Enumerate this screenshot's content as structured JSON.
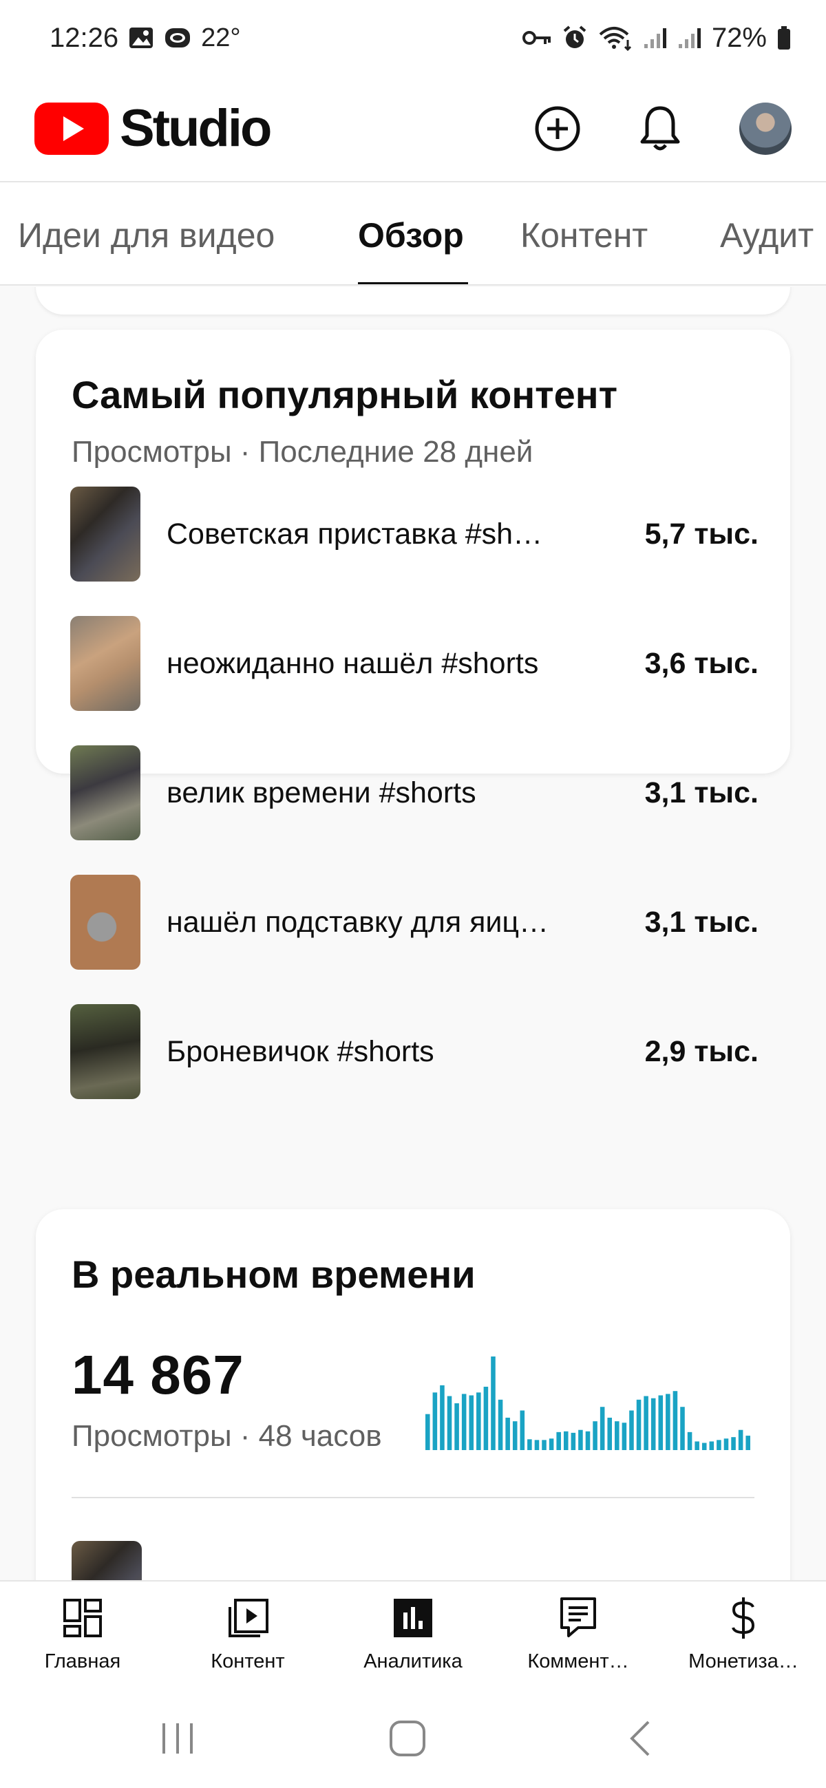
{
  "status_bar": {
    "time": "12:26",
    "temperature": "22°",
    "battery": "72%",
    "icons": [
      "image-icon",
      "outlook-icon",
      "key-icon",
      "alarm-icon",
      "wifi-icon",
      "signal-icon",
      "signal-icon",
      "battery-icon"
    ]
  },
  "header": {
    "app_name": "Studio",
    "brand_color": "#ff0000",
    "icons": [
      "create-icon",
      "notifications-icon",
      "avatar"
    ]
  },
  "tabs": [
    {
      "label": "Идеи для видео",
      "active": false
    },
    {
      "label": "Обзор",
      "active": true
    },
    {
      "label": "Контент",
      "active": false
    },
    {
      "label": "Аудит",
      "active": false
    }
  ],
  "top_content": {
    "title": "Самый популярный контент",
    "subtitle": "Просмотры · Последние 28 дней",
    "items": [
      {
        "title": "Советская приставка #sh…",
        "views": "5,7 тыс."
      },
      {
        "title": "неожиданно нашёл #shorts",
        "views": "3,6 тыс."
      },
      {
        "title": "велик времени #shorts",
        "views": "3,1 тыс."
      },
      {
        "title": "нашёл подставку для яиц…",
        "views": "3,1 тыс."
      },
      {
        "title": "Броневичок #shorts",
        "views": "2,9 тыс."
      }
    ]
  },
  "realtime": {
    "title": "В реальном времени",
    "views_count": "14 867",
    "subtitle": "Просмотры · 48 часов",
    "bar_color": "#1aa3c4",
    "hourly_bars": [
      50,
      80,
      90,
      75,
      65,
      78,
      76,
      80,
      88,
      130,
      70,
      45,
      40,
      55,
      15,
      14,
      14,
      16,
      25,
      26,
      24,
      28,
      26,
      40,
      60,
      45,
      40,
      38,
      55,
      70,
      75,
      72,
      76,
      78,
      82,
      60,
      25,
      12,
      10,
      12,
      14,
      16,
      18,
      28,
      20
    ]
  },
  "bottom_nav": [
    {
      "label": "Главная",
      "icon": "dashboard-icon",
      "active": false
    },
    {
      "label": "Контент",
      "icon": "content-icon",
      "active": false
    },
    {
      "label": "Аналитика",
      "icon": "analytics-icon",
      "active": true
    },
    {
      "label": "Коммент…",
      "icon": "comments-icon",
      "active": false
    },
    {
      "label": "Монетиза…",
      "icon": "monetization-icon",
      "active": false
    }
  ],
  "system_nav": [
    "recents-icon",
    "home-icon",
    "back-icon"
  ]
}
